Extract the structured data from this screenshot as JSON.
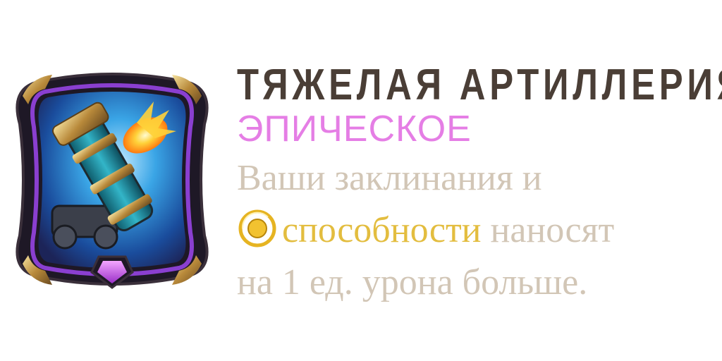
{
  "card": {
    "title": "ТЯЖЕЛАЯ АРТИЛЛЕРИЯ",
    "rarity": "ЭПИЧЕСКОЕ",
    "rarity_color": "#e57ee5",
    "description": {
      "line1": "Ваши заклинания и",
      "keyword": "способности",
      "keyword_icon": "ability-ring-icon",
      "line2_rest": " наносят",
      "line3": "на 1 ед. урона больше."
    },
    "portrait_icon": "heavy-artillery-cannon-icon",
    "rarity_gem_icon": "epic-gem-icon",
    "colors": {
      "title": "#4a3e36",
      "description": "#d2c6b6",
      "keyword": "#e3bd3f",
      "frame_purple": "#8a3fd0"
    }
  }
}
